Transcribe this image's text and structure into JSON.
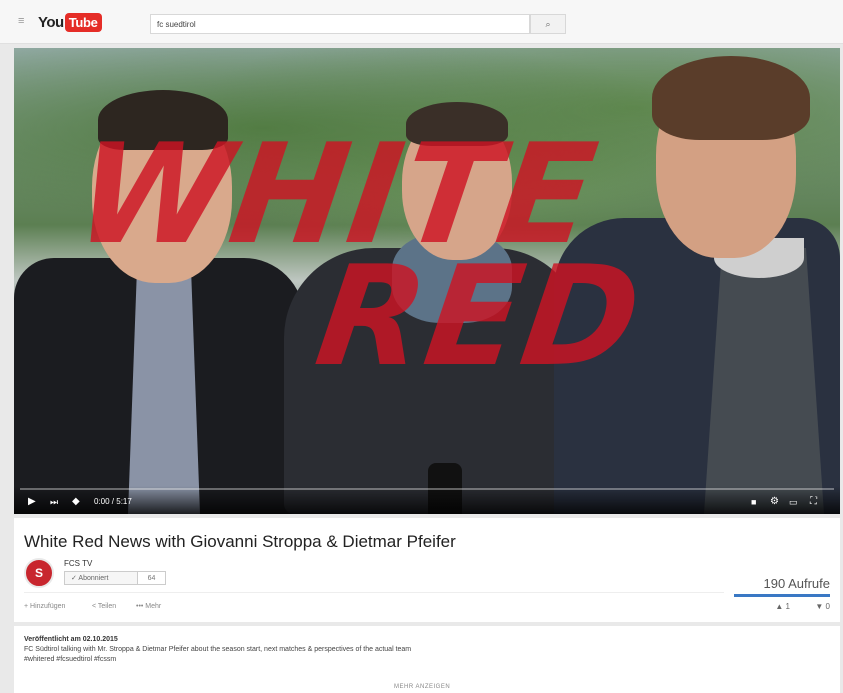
{
  "masthead": {
    "logo_you": "You",
    "logo_tube": "Tube",
    "search_value": "fc suedtirol",
    "menu_glyph": "≡",
    "search_glyph": "⌕"
  },
  "player": {
    "overlay_line1": "WHITE",
    "overlay_line2": "RED",
    "time_display": "0:00 / 5:17",
    "progress_fraction": 0.0,
    "icons": {
      "play": "▶",
      "next": "⏭",
      "volume": "◆",
      "subtitles": "■",
      "settings": "⚙",
      "theater": "▭",
      "fullscreen": "⛶"
    }
  },
  "video": {
    "title": "White Red News with Giovanni Stroppa & Dietmar Pfeifer",
    "channel": "FCS TV",
    "channel_initials": "S",
    "subscribe_label": "✓ Abonniert",
    "subscriber_count": "64",
    "views": "190 Aufrufe",
    "like_ratio": 1.0,
    "actions": {
      "add_to": "+ Hinzufügen",
      "share": "< Teilen",
      "more": "••• Mehr"
    },
    "like_label": "▲ 1",
    "dislike_label": "▼ 0"
  },
  "description": {
    "published": "Veröffentlicht am 02.10.2015",
    "line1": "FC Südtirol talking with Mr. Stroppa & Dietmar Pfeifer about the season start, next matches & perspectives of the actual team",
    "line2": "#whitered #fcsuedtirol #fcssm",
    "show_more": "MEHR ANZEIGEN"
  },
  "colors": {
    "brand_red": "#e52d27",
    "overlay_red": "#cd1423",
    "like_blue": "#3a78c4"
  }
}
